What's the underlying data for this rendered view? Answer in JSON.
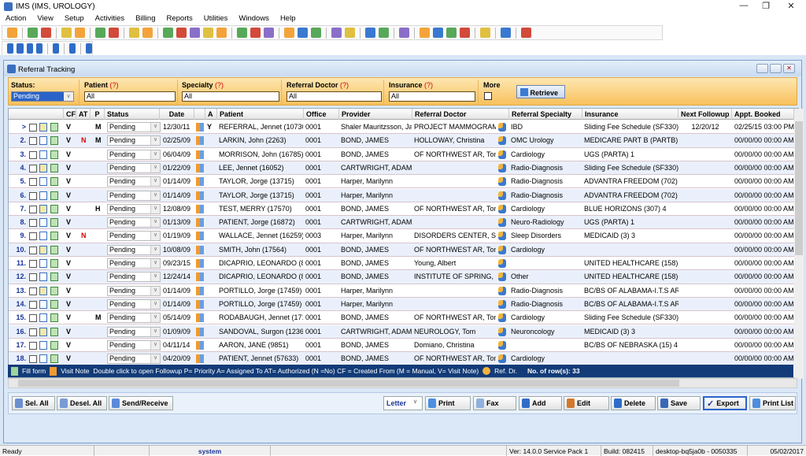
{
  "app": {
    "title": "IMS (IMS, UROLOGY)"
  },
  "menu": [
    "Action",
    "View",
    "Setup",
    "Activities",
    "Billing",
    "Reports",
    "Utilities",
    "Windows",
    "Help"
  ],
  "toolbar1": [
    "user-icon",
    "sep",
    "doctor-icon",
    "doctor-edit-icon",
    "sep",
    "folder-icon",
    "notes-icon",
    "sep",
    "clipboard-icon",
    "lab-flask-icon",
    "sep",
    "form-icon",
    "window-icon",
    "sep",
    "dollar-icon",
    "payment-icon",
    "ledger-icon",
    "billing-icon",
    "claims-icon",
    "sep",
    "calendar-grid-icon",
    "tools-icon",
    "document-a-icon",
    "sep",
    "scanner-icon",
    "globe-icon",
    "globe-x-icon",
    "sep",
    "chart-edit-icon",
    "chart-check-icon",
    "sep",
    "bar-chart-icon",
    "patient-folder-icon",
    "sep",
    "report-icon",
    "sep",
    "recall-icon",
    "transfer-icon",
    "edit-list-icon",
    "calculator-icon",
    "sep",
    "help-icon",
    "sep",
    "lock-icon",
    "sep",
    "exit-icon"
  ],
  "toolbar2": [
    "first-record-icon",
    "previous-record-icon",
    "next-record-icon",
    "last-record-icon",
    "sep",
    "refresh-icon",
    "sep",
    "help-icon",
    "sep",
    "close-icon"
  ],
  "window": {
    "title": "Referral Tracking"
  },
  "filters": {
    "status": {
      "label": "Status:",
      "value": "Pending"
    },
    "patient": {
      "label": "Patient",
      "hint": "(?)",
      "value": "All"
    },
    "specialty": {
      "label": "Specialty",
      "hint": "(?)",
      "value": "All"
    },
    "referral_doctor": {
      "label": "Referral Doctor",
      "hint": "(?)",
      "value": "All"
    },
    "insurance": {
      "label": "Insurance",
      "hint": "(?)",
      "value": "All"
    },
    "more": {
      "label": "More",
      "checked": false
    },
    "retrieve": "Retrieve"
  },
  "columns": [
    "CF",
    "AT",
    "P",
    "Status",
    "Date",
    "A",
    "Patient",
    "Office",
    "Provider",
    "Referral Doctor",
    "Referral Specialty",
    "Insurance",
    "Next Followup",
    "Appt. Booked"
  ],
  "rows": [
    {
      "n": ">",
      "cf": "V",
      "at": "",
      "p": "M",
      "status": "Pending",
      "date": "12/30/11",
      "a": "Y",
      "patient": "REFERRAL, Jennet (10730)",
      "office": "0001",
      "provider": "Shaler Mauritzsson, Jay",
      "refdoc": "PROJECT MAMMOGRAM, J",
      "spec": "IBD",
      "ins": "Sliding Fee Schedule   (SF330)",
      "next": "12/20/12",
      "appt": "02/25/15   03:00 PM"
    },
    {
      "n": "2.",
      "cf": "V",
      "at": "N",
      "p": "M",
      "status": "Pending",
      "date": "02/25/09",
      "a": "",
      "patient": "LARKIN, John (2263)",
      "office": "0001",
      "provider": "BOND, JAMES",
      "refdoc": "HOLLOWAY, Christina",
      "spec": "OMC Urology",
      "ins": "MEDICARE PART B   (PARTB)",
      "next": "",
      "appt": "00/00/00   00:00 AM"
    },
    {
      "n": "3.",
      "cf": "V",
      "at": "",
      "p": "",
      "status": "Pending",
      "date": "06/04/09",
      "a": "",
      "patient": "MORRISON, John (16785)",
      "office": "0001",
      "provider": "BOND, JAMES",
      "refdoc": "OF NORTHWEST AR, Tom",
      "spec": "Cardiology",
      "ins": "UGS   (PARTA)    1",
      "next": "",
      "appt": "00/00/00   00:00 AM"
    },
    {
      "n": "4.",
      "cf": "V",
      "at": "",
      "p": "",
      "status": "Pending",
      "date": "01/22/09",
      "a": "",
      "patient": "LEE, Jennet (16052)",
      "office": "0001",
      "provider": "CARTWRIGHT, ADAM",
      "refdoc": "",
      "spec": "Radio-Diagnosis",
      "ins": "Sliding Fee Schedule   (SF330)",
      "next": "",
      "appt": "00/00/00   00:00 AM"
    },
    {
      "n": "5.",
      "cf": "V",
      "at": "",
      "p": "",
      "status": "Pending",
      "date": "01/14/09",
      "a": "",
      "patient": "TAYLOR, Jorge (13715)",
      "office": "0001",
      "provider": "Harper, Marilynn",
      "refdoc": "",
      "spec": "Radio-Diagnosis",
      "ins": "ADVANTRA FREEDOM     (702)",
      "next": "",
      "appt": "00/00/00   00:00 AM"
    },
    {
      "n": "6.",
      "cf": "V",
      "at": "",
      "p": "",
      "status": "Pending",
      "date": "01/14/09",
      "a": "",
      "patient": "TAYLOR, Jorge (13715)",
      "office": "0001",
      "provider": "Harper, Marilynn",
      "refdoc": "",
      "spec": "Radio-Diagnosis",
      "ins": "ADVANTRA FREEDOM     (702)",
      "next": "",
      "appt": "00/00/00   00:00 AM"
    },
    {
      "n": "7.",
      "cf": "V",
      "at": "",
      "p": "H",
      "status": "Pending",
      "date": "12/08/09",
      "a": "",
      "patient": "TEST, MERRY (17570)",
      "office": "0001",
      "provider": "BOND, JAMES",
      "refdoc": "OF NORTHWEST AR, Tom",
      "spec": "Cardiology",
      "ins": "BLUE HORIZONS   (307)    4",
      "next": "",
      "appt": "00/00/00   00:00 AM"
    },
    {
      "n": "8.",
      "cf": "V",
      "at": "",
      "p": "",
      "status": "Pending",
      "date": "01/13/09",
      "a": "",
      "patient": "PATIENT, Jorge (16872)",
      "office": "0001",
      "provider": "CARTWRIGHT, ADAM",
      "refdoc": "",
      "spec": "Neuro-Radiology",
      "ins": "UGS   (PARTA)    1",
      "next": "",
      "appt": "00/00/00   00:00 AM"
    },
    {
      "n": "9.",
      "cf": "V",
      "at": "N",
      "p": "",
      "status": "Pending",
      "date": "01/19/09",
      "a": "",
      "patient": "WALLACE, Jennet (16259)",
      "office": "0003",
      "provider": "Harper, Marilynn",
      "refdoc": "DISORDERS CENTER, Serv",
      "spec": "Sleep Disorders",
      "ins": "MEDICAID   (3)    3",
      "next": "",
      "appt": "00/00/00   00:00 AM"
    },
    {
      "n": "10.",
      "cf": "V",
      "at": "",
      "p": "",
      "status": "Pending",
      "date": "10/08/09",
      "a": "",
      "patient": "SMITH, John (17564)",
      "office": "0001",
      "provider": "BOND, JAMES",
      "refdoc": "OF NORTHWEST AR, Tom",
      "spec": "Cardiology",
      "ins": "",
      "next": "",
      "appt": "00/00/00   00:00 AM"
    },
    {
      "n": "11.",
      "cf": "V",
      "at": "",
      "p": "",
      "status": "Pending",
      "date": "09/23/15",
      "a": "",
      "patient": "DICAPRIO, LEONARDO (857",
      "office": "0001",
      "provider": "BOND, JAMES",
      "refdoc": "Young, Albert",
      "spec": "",
      "ins": "UNITED HEALTHCARE    (158)",
      "next": "",
      "appt": "00/00/00   00:00 AM"
    },
    {
      "n": "12.",
      "cf": "V",
      "at": "",
      "p": "",
      "status": "Pending",
      "date": "12/24/14",
      "a": "",
      "patient": "DICAPRIO, LEONARDO (857",
      "office": "0001",
      "provider": "BOND, JAMES",
      "refdoc": "INSTITUTE OF SPRING, Ch",
      "spec": "Other",
      "ins": "UNITED HEALTHCARE    (158)",
      "next": "",
      "appt": "00/00/00   00:00 AM"
    },
    {
      "n": "13.",
      "cf": "V",
      "at": "",
      "p": "",
      "status": "Pending",
      "date": "01/14/09",
      "a": "",
      "patient": "PORTILLO, Jorge (17459)",
      "office": "0001",
      "provider": "Harper, Marilynn",
      "refdoc": "",
      "spec": "Radio-Diagnosis",
      "ins": "BC/BS OF ALABAMA-I.T.S AREA",
      "next": "",
      "appt": "00/00/00   00:00 AM"
    },
    {
      "n": "14.",
      "cf": "V",
      "at": "",
      "p": "",
      "status": "Pending",
      "date": "01/14/09",
      "a": "",
      "patient": "PORTILLO, Jorge (17459)",
      "office": "0001",
      "provider": "Harper, Marilynn",
      "refdoc": "",
      "spec": "Radio-Diagnosis",
      "ins": "BC/BS OF ALABAMA-I.T.S AREA",
      "next": "",
      "appt": "00/00/00   00:00 AM"
    },
    {
      "n": "15.",
      "cf": "V",
      "at": "",
      "p": "M",
      "status": "Pending",
      "date": "05/14/09",
      "a": "",
      "patient": "RODABAUGH, Jennet (17168",
      "office": "0001",
      "provider": "BOND, JAMES",
      "refdoc": "OF NORTHWEST AR, Tom",
      "spec": "Cardiology",
      "ins": "Sliding Fee Schedule   (SF330)",
      "next": "",
      "appt": "00/00/00   00:00 AM"
    },
    {
      "n": "16.",
      "cf": "V",
      "at": "",
      "p": "",
      "status": "Pending",
      "date": "01/09/09",
      "a": "",
      "patient": "SANDOVAL, Surgon (12367)",
      "office": "0001",
      "provider": "CARTWRIGHT, ADAM",
      "refdoc": "NEUROLOGY, Tom",
      "spec": "Neuroncology",
      "ins": "MEDICAID   (3)    3",
      "next": "",
      "appt": "00/00/00   00:00 AM"
    },
    {
      "n": "17.",
      "cf": "V",
      "at": "",
      "p": "",
      "status": "Pending",
      "date": "04/11/14",
      "a": "",
      "patient": "AARON, JANE (9851)",
      "office": "0001",
      "provider": "BOND, JAMES",
      "refdoc": "Domiano, Christina",
      "spec": "",
      "ins": "BC/BS OF NEBRASKA   (15)    4",
      "next": "",
      "appt": "00/00/00   00:00 AM"
    },
    {
      "n": "18.",
      "cf": "V",
      "at": "",
      "p": "",
      "status": "Pending",
      "date": "04/20/09",
      "a": "",
      "patient": "PATIENT, Jennet (57633)",
      "office": "0001",
      "provider": "BOND, JAMES",
      "refdoc": "OF NORTHWEST AR, Tom",
      "spec": "Cardiology",
      "ins": "",
      "next": "",
      "appt": "00/00/00   00:00 AM"
    }
  ],
  "legend": {
    "fill_form": "Fill form",
    "visit_note": "Visit Note",
    "text": "Double click to open Followup  P= Priority  A= Assigned To  AT= Authorized (N =No)  CF = Created From (M = Manual, V= Visit Note)",
    "ref_dr": "Ref. Dr.",
    "row_count": "No. of row(s): 33"
  },
  "buttons": {
    "sel_all": "Sel. All",
    "desel_all": "Desel. All",
    "send_receive": "Send/Receive",
    "paper": "Letter",
    "print": "Print",
    "fax": "Fax",
    "add": "Add",
    "edit": "Edit",
    "delete": "Delete",
    "save": "Save",
    "export": "Export",
    "print_list": "Print List"
  },
  "status": {
    "state": "Ready",
    "user": "system",
    "version": "Ver: 14.0.0 Service Pack 1",
    "build": "Build: 082415",
    "machine": "desktop-bq5ja0b - 0050335",
    "date": "05/02/2017"
  },
  "colors": {
    "accent": "#123b78",
    "filter": "#f8c05c",
    "alt_row": "#eaf0fb",
    "flag_red": "#e00000"
  }
}
